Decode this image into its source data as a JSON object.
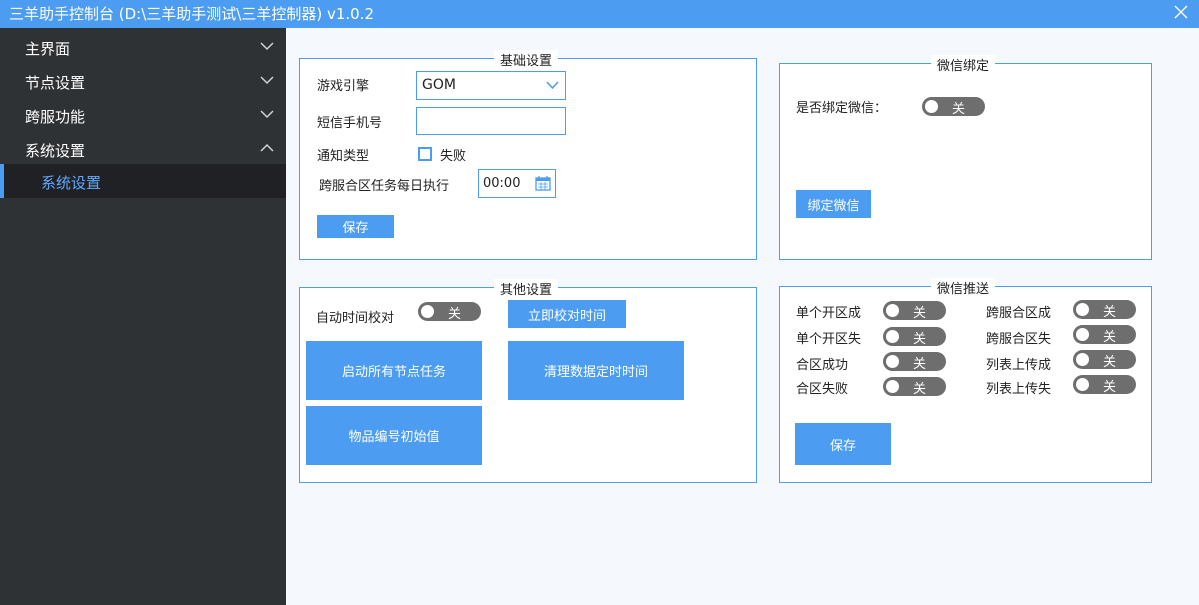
{
  "window": {
    "title": "三羊助手控制台 (D:\\三羊助手测试\\三羊控制器) v1.0.2",
    "close_icon": "close-icon"
  },
  "sidebar": {
    "items": [
      {
        "label": "主界面",
        "icon": "chevron-down-icon"
      },
      {
        "label": "节点设置",
        "icon": "chevron-down-icon"
      },
      {
        "label": "跨服功能",
        "icon": "chevron-down-icon"
      },
      {
        "label": "系统设置",
        "icon": "chevron-up-icon"
      }
    ],
    "subitem": {
      "label": "系统设置",
      "active": true
    }
  },
  "basic": {
    "title": "基础设置",
    "engine_label": "游戏引擎",
    "engine_value": "GOM",
    "sms_label": "短信手机号",
    "sms_value": "",
    "notify_label": "通知类型",
    "notify_option": "失败",
    "notify_checked": false,
    "cross_label": "跨服合区任务每日执行",
    "cross_time": "00:00",
    "save": "保存"
  },
  "wechat_bind": {
    "title": "微信绑定",
    "bind_label": "是否绑定微信：",
    "bind_toggle": "关",
    "bind_button": "绑定微信"
  },
  "other": {
    "title": "其他设置",
    "auto_time_label": "自动时间校对",
    "auto_time_toggle": "关",
    "calibrate_now": "立即校对时间",
    "start_all": "启动所有节点任务",
    "clean_timer": "清理数据定时时间",
    "item_init": "物品编号初始值"
  },
  "wechat_push": {
    "title": "微信推送",
    "left": [
      {
        "label": "单个开区成",
        "toggle": "关"
      },
      {
        "label": "单个开区失",
        "toggle": "关"
      },
      {
        "label": "合区成功",
        "toggle": "关"
      },
      {
        "label": "合区失败",
        "toggle": "关"
      }
    ],
    "right": [
      {
        "label": "跨服合区成",
        "toggle": "关"
      },
      {
        "label": "跨服合区失",
        "toggle": "关"
      },
      {
        "label": "列表上传成",
        "toggle": "关"
      },
      {
        "label": "列表上传失",
        "toggle": "关"
      }
    ],
    "save": "保存"
  },
  "colors": {
    "accent": "#4c9df2",
    "sidebar_bg": "#2f3235",
    "sidebar_active_bg": "#1f2124",
    "toggle_off": "#6e6e6e"
  }
}
